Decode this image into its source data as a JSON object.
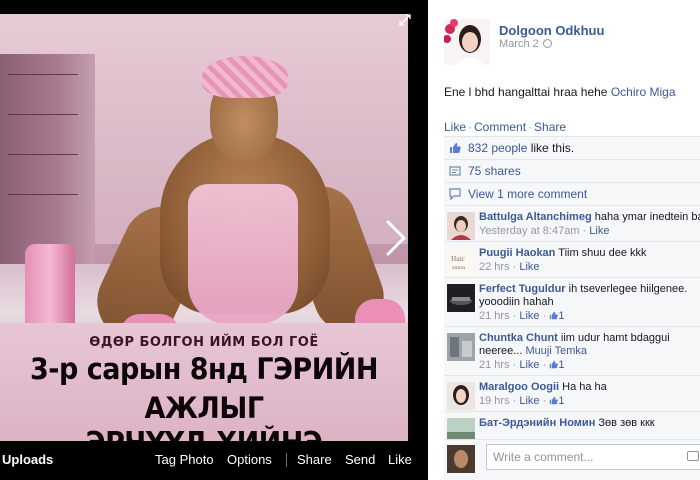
{
  "photo_viewer": {
    "caption_small": "ӨДӨР БОЛГОН ИЙМ БОЛ ГОЁ",
    "caption_line1": "3-р сарын 8нд ГЭРИЙН АЖЛЫГ",
    "caption_line2": "ЭРЧҮҮД ХИЙНЭ",
    "bar": {
      "uploads": "Uploads",
      "tag_photo": "Tag Photo",
      "options": "Options",
      "share": "Share",
      "send": "Send",
      "like": "Like"
    }
  },
  "post": {
    "author": "Dolgoon Odkhuu",
    "date": "March 2",
    "text": "Ene l bhd hangalttai hraa hehe",
    "mention": "Ochiro Miga",
    "actions": {
      "like": "Like",
      "comment": "Comment",
      "share": "Share",
      "sep": "·"
    }
  },
  "ufi": {
    "likes_link": "832 people",
    "likes_suffix": " like this.",
    "shares": "75 shares",
    "view_more": "View 1 more comment"
  },
  "comments": [
    {
      "name": "Battulga Altanchimeg",
      "text": "haha ymar inedtein bai",
      "meta_time": "Yesterday at 8:47am",
      "meta_like": "Like",
      "likes": ""
    },
    {
      "name": "Puugii Haokan",
      "text": "Tiim shuu dee kkk",
      "meta_time": "22 hrs",
      "meta_like": "Like",
      "likes": ""
    },
    {
      "name": "Ferfect Tuguldur",
      "text": "ih tseverlegee hiilgenee.",
      "text2": "yooodiin hahah",
      "meta_time": "21 hrs",
      "meta_like": "Like",
      "likes": "1"
    },
    {
      "name": "Chuntka Chunt",
      "text": "iim udur hamt bdaggui",
      "text2": "neeree...",
      "mention": "Muuji Temka",
      "meta_time": "21 hrs",
      "meta_like": "Like",
      "likes": "1"
    },
    {
      "name": "Maralgoo Oogii",
      "text": "Ha ha ha",
      "meta_time": "19 hrs",
      "meta_like": "Like",
      "likes": "1"
    },
    {
      "name": "Бат-Эрдэнийн Номин",
      "text": "Зөв зөв ккк",
      "meta_time": "",
      "meta_like": "",
      "likes": ""
    }
  ],
  "composer": {
    "placeholder": "Write a comment..."
  },
  "colors": {
    "link": "#3b5998",
    "muted": "#9197a3",
    "panel_bg": "#ffffff",
    "ufi_bg": "#f6f7f9"
  },
  "icons": [
    "expand-icon",
    "next-arrow-icon",
    "globe-icon",
    "thumbs-up-icon",
    "share-icon",
    "comment-bubble-icon",
    "camera-icon"
  ]
}
